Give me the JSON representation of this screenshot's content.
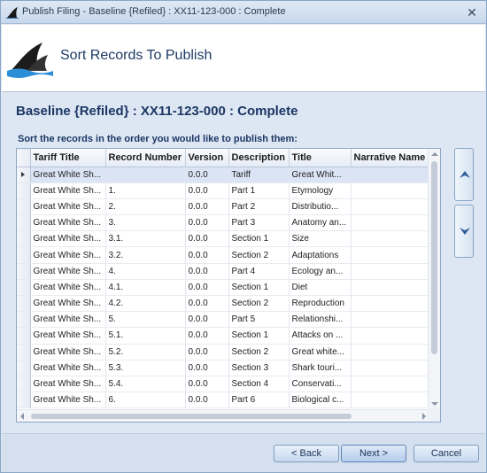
{
  "window": {
    "title": "Publish Filing - Baseline {Refiled} : XX11-123-000 : Complete"
  },
  "header": {
    "heading": "Sort Records To Publish"
  },
  "content": {
    "filing_title": "Baseline {Refiled} : XX11-123-000 : Complete",
    "instructions": "Sort the records in the order you would like to publish them:"
  },
  "grid": {
    "columns": [
      "Tariff Title",
      "Record Number",
      "Version",
      "Description",
      "Title",
      "Narrative Name"
    ],
    "rows": [
      [
        "Great White Sh...",
        "",
        "0.0.0",
        "Tariff",
        "Great Whit..."
      ],
      [
        "Great White Sh...",
        "1.",
        "0.0.0",
        "Part 1",
        "Etymology"
      ],
      [
        "Great White Sh...",
        "2.",
        "0.0.0",
        "Part 2",
        "Distributio..."
      ],
      [
        "Great White Sh...",
        "3.",
        "0.0.0",
        "Part 3",
        "Anatomy an..."
      ],
      [
        "Great White Sh...",
        "3.1.",
        "0.0.0",
        "Section 1",
        "Size"
      ],
      [
        "Great White Sh...",
        "3.2.",
        "0.0.0",
        "Section 2",
        "Adaptations"
      ],
      [
        "Great White Sh...",
        "4.",
        "0.0.0",
        "Part 4",
        "Ecology an..."
      ],
      [
        "Great White Sh...",
        "4.1.",
        "0.0.0",
        "Section 1",
        "Diet"
      ],
      [
        "Great White Sh...",
        "4.2.",
        "0.0.0",
        "Section 2",
        "Reproduction"
      ],
      [
        "Great White Sh...",
        "5.",
        "0.0.0",
        "Part 5",
        "Relationshi..."
      ],
      [
        "Great White Sh...",
        "5.1.",
        "0.0.0",
        "Section 1",
        "Attacks on ..."
      ],
      [
        "Great White Sh...",
        "5.2.",
        "0.0.0",
        "Section 2",
        "Great white..."
      ],
      [
        "Great White Sh...",
        "5.3.",
        "0.0.0",
        "Section 3",
        "Shark touri..."
      ],
      [
        "Great White Sh...",
        "5.4.",
        "0.0.0",
        "Section 4",
        "Conservati..."
      ],
      [
        "Great White Sh...",
        "6.",
        "0.0.0",
        "Part 6",
        "Biological c..."
      ]
    ],
    "selected_row": 0
  },
  "buttons": {
    "back": "< Back",
    "next": "Next >",
    "cancel": "Cancel"
  },
  "icons": {
    "app": "shark-fin-icon",
    "close": "close-icon",
    "move_up": "move-up-icon",
    "move_down": "move-down-icon"
  },
  "colors": {
    "accent": "#1b3664",
    "selection": "#dbe4f5"
  }
}
